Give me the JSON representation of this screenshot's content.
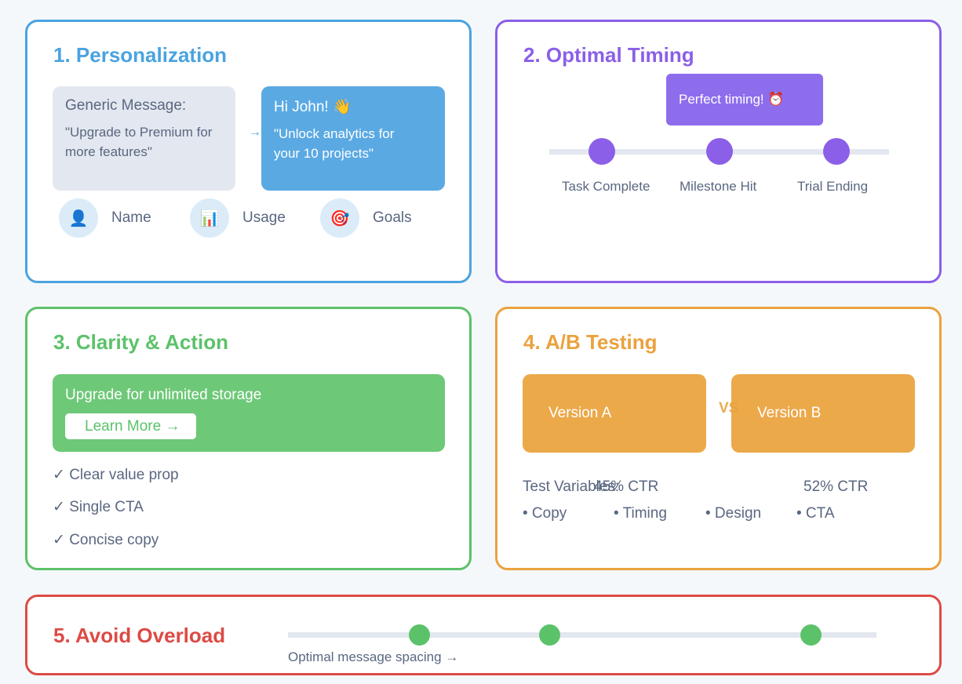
{
  "colors": {
    "blue": "#4aa3e0",
    "purple": "#8b5fe8",
    "green": "#5cc26a",
    "orange": "#eaa23e",
    "red": "#dc4b45"
  },
  "personalization": {
    "title": "1. Personalization",
    "generic_label": "Generic Message:",
    "generic_text": "\"Upgrade to Premium for more features\"",
    "arrow": "→",
    "personal_greeting": "Hi John! 👋",
    "personal_text": "\"Unlock analytics for your 10 projects\"",
    "factors": [
      {
        "icon": "👤",
        "label": "Name"
      },
      {
        "icon": "📊",
        "label": "Usage"
      },
      {
        "icon": "🎯",
        "label": "Goals"
      }
    ]
  },
  "timing": {
    "title": "2. Optimal Timing",
    "callout": "Perfect timing! ⏰",
    "events": [
      "Task Complete",
      "Milestone Hit",
      "Trial Ending"
    ]
  },
  "clarity": {
    "title": "3. Clarity & Action",
    "banner_text": "Upgrade for unlimited storage",
    "cta_label": "Learn More →",
    "checklist": [
      "✓ Clear value prop",
      "✓ Single CTA",
      "✓ Concise copy"
    ]
  },
  "ab_testing": {
    "title": "4. A/B Testing",
    "version_a": "Version A",
    "version_b": "Version B",
    "vs": "VS",
    "ctr_a": "45% CTR",
    "ctr_b": "52% CTR",
    "variables_label": "Test Variables:",
    "variables": [
      "• Copy",
      "• Timing",
      "• Design",
      "• CTA"
    ]
  },
  "overload": {
    "title": "5. Avoid Overload",
    "caption": "Optimal message spacing →",
    "message_count": 3
  }
}
